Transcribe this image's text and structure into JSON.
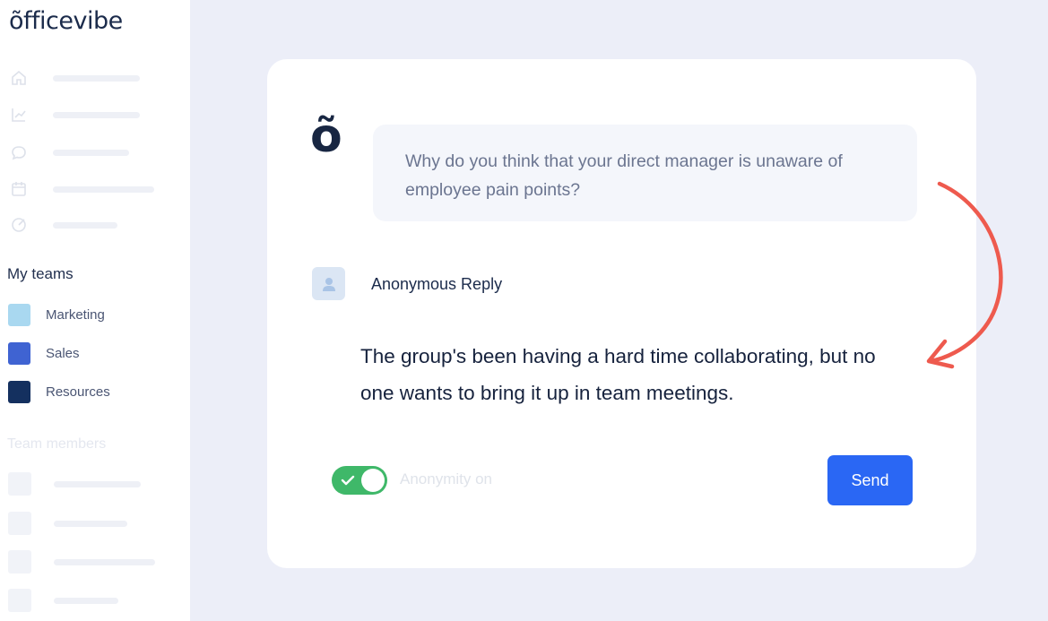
{
  "sidebar": {
    "logo": "õfficevibe",
    "nav_icons": [
      "home-icon",
      "chart-icon",
      "chat-icon",
      "calendar-icon",
      "target-icon"
    ],
    "my_teams_title": "My teams",
    "teams": [
      {
        "label": "Marketing",
        "color": "#a9d8f0"
      },
      {
        "label": "Sales",
        "color": "#3f63d2"
      },
      {
        "label": "Resources",
        "color": "#14305f"
      }
    ],
    "members_title": "Team members"
  },
  "card": {
    "brand_glyph": "õ",
    "question": "Why do you think that your direct manager is unaware of employee pain points?",
    "reply_author": "Anonymous Reply",
    "reply_text": "The group's been having a hard time collaborating, but no one wants to bring it up in team meetings.",
    "anonymity_label": "Anonymity on",
    "anonymity_on": true,
    "send_label": "Send"
  },
  "colors": {
    "background": "#eceef8",
    "send_button": "#2a67f4",
    "toggle_on": "#3fb869",
    "arrow": "#ee5a4e",
    "brand_dark": "#1b2b4b"
  }
}
